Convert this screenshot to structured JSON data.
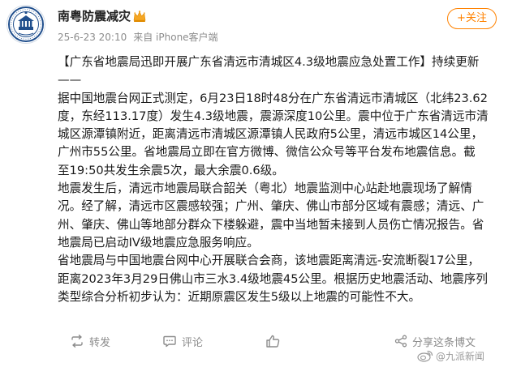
{
  "post": {
    "author": {
      "name": "南粤防震减灾",
      "avatar_icon": "earthquake-administration-seal",
      "verified_icon": "gold-verified-crown"
    },
    "timestamp": "25-6-23 20:10",
    "source": "来自 iPhone客户端",
    "follow_label": "+关注",
    "content": {
      "paragraphs": [
        "【广东省地震局迅即开展广东省清远市清城区4.3级地震应急处置工作】持续更新\n——",
        "据中国地震台网正式测定，6月23日18时48分在广东省清远市清城区（北纬23.62\n度，东经113.17度）发生4.3级地震，震源深度10公里。震中位于广东省清远市清\n城区源潭镇附近，距离清远市清城区源潭镇人民政府5公里，清远市城区14公里，\n广州市55公里。省地震局立即在官方微博、微信公众号等平台发布地震信息。截\n至19:50共发生余震5次，最大余震0.6级。",
        "地震发生后，清远市地震局联合韶关（粤北）地震监测中心站赴地震现场了解情\n况。经了解，清远市区震感较强；广州、肇庆、佛山市部分区域有震感；清远、广\n州、肇庆、佛山等地部分群众下楼躲避，震中当地暂未接到人员伤亡情况报告。省\n地震局已启动IV级地震应急服务响应。",
        "省地震局与中国地震台网中心开展联合会商，该地震距离清远-安流断裂17公里，\n距离2023年3月29日佛山市三水3.4级地震45公里。根据历史地震活动、地震序列\n类型综合分析初步认为：近期原震区发生5级以上地震的可能性不大。"
      ]
    },
    "actions": {
      "repost_label": "转发",
      "comment_label": "评论",
      "share_label": "分享这条博文"
    },
    "watermark": "@九派新闻",
    "colors": {
      "accent": "#ff8200",
      "meta_text": "#8c8c8c",
      "seal_blue": "#1f4e8c"
    }
  }
}
